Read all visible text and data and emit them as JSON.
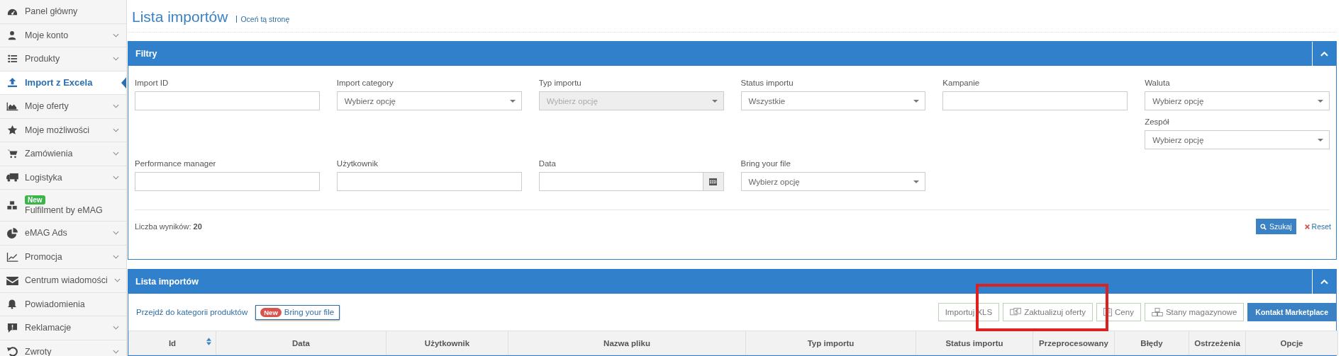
{
  "sidebar": {
    "items": [
      {
        "label": "Panel główny",
        "selected": false,
        "has_submenu": false
      },
      {
        "label": "Moje konto",
        "selected": false,
        "has_submenu": true
      },
      {
        "label": "Produkty",
        "selected": false,
        "has_submenu": true
      },
      {
        "label": "Import z Excela",
        "selected": true,
        "has_submenu": false
      },
      {
        "label": "Moje oferty",
        "selected": false,
        "has_submenu": true
      },
      {
        "label": "Moje możliwości",
        "selected": false,
        "has_submenu": true
      },
      {
        "label": "Zamówienia",
        "selected": false,
        "has_submenu": true
      },
      {
        "label": "Logistyka",
        "selected": false,
        "has_submenu": true
      },
      {
        "label": "Fulfilment by eMAG",
        "selected": false,
        "has_submenu": false,
        "badge": "New"
      },
      {
        "label": "eMAG Ads",
        "selected": false,
        "has_submenu": true
      },
      {
        "label": "Promocja",
        "selected": false,
        "has_submenu": true
      },
      {
        "label": "Centrum wiadomości",
        "selected": false,
        "has_submenu": true
      },
      {
        "label": "Powiadomienia",
        "selected": false,
        "has_submenu": false
      },
      {
        "label": "Reklamacje",
        "selected": false,
        "has_submenu": true
      },
      {
        "label": "Zwroty",
        "selected": false,
        "has_submenu": true
      }
    ]
  },
  "page": {
    "title": "Lista importów",
    "rate_link": "Oceń tą stronę"
  },
  "filters": {
    "title": "Filtry",
    "rows": [
      {
        "fields": [
          {
            "label": "Import ID",
            "kind": "text",
            "disabled": false
          },
          {
            "label": "Import category",
            "kind": "select",
            "placeholder": "Wybierz opcję",
            "disabled": false
          },
          {
            "label": "Typ importu",
            "kind": "select",
            "placeholder": "Wybierz opcję",
            "disabled": true
          },
          {
            "label": "Status importu",
            "kind": "select",
            "value": "Wszystkie",
            "disabled": false
          },
          {
            "label": "Kampanie",
            "kind": "text",
            "disabled": false
          },
          {
            "label": "Waluta",
            "kind": "select",
            "placeholder": "Wybierz opcję",
            "disabled": false
          }
        ]
      },
      {
        "fields": [
          {
            "label": "Zespół",
            "kind": "select",
            "placeholder": "Wybierz opcję",
            "disabled": false
          }
        ]
      },
      {
        "fields": [
          {
            "label": "Performance manager",
            "kind": "text",
            "disabled": false
          },
          {
            "label": "Użytkownik",
            "kind": "text",
            "disabled": false
          },
          {
            "label": "Data",
            "kind": "date",
            "disabled": false
          },
          {
            "label": "Bring your file",
            "kind": "select",
            "placeholder": "Wybierz opcję",
            "disabled": false
          }
        ]
      }
    ],
    "result_label": "Liczba wyników:",
    "result_count": "20",
    "search_button": "Szukaj",
    "reset_button": "Reset"
  },
  "imports": {
    "title": "Lista importów",
    "category_link": "Przejdź do kategorii produktów",
    "bring_badge": "New",
    "bring_button": "Bring your file",
    "buttons": [
      {
        "label": "Importuj XLS",
        "kind": "outline",
        "highlighted": false
      },
      {
        "label": "Zaktualizuj oferty",
        "kind": "outline",
        "highlighted": true
      },
      {
        "label": "Ceny",
        "kind": "outline",
        "highlighted": false
      },
      {
        "label": "Stany magazynowe",
        "kind": "outline",
        "highlighted": false
      },
      {
        "label": "Kontakt Marketplace",
        "kind": "primary",
        "highlighted": false
      }
    ],
    "columns": [
      {
        "label": "Id",
        "sortable": true
      },
      {
        "label": "Data",
        "sortable": false
      },
      {
        "label": "Użytkownik",
        "sortable": false
      },
      {
        "label": "Nazwa pliku",
        "sortable": false
      },
      {
        "label": "Typ importu",
        "sortable": false
      },
      {
        "label": "Status importu",
        "sortable": false
      },
      {
        "label": "Przeprocesowany",
        "sortable": false
      },
      {
        "label": "Błędy",
        "sortable": false
      },
      {
        "label": "Ostrzeżenia",
        "sortable": false
      },
      {
        "label": "Opcje",
        "sortable": false
      }
    ]
  }
}
